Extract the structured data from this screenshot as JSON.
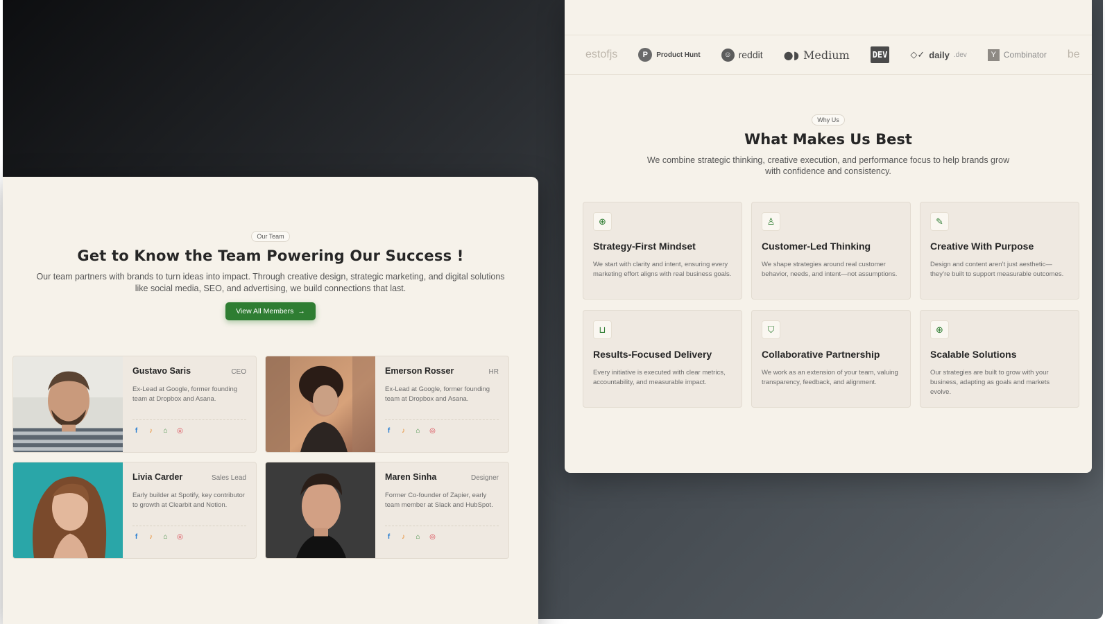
{
  "team": {
    "badge": "Our Team",
    "title": "Get to Know the Team Powering Our Success !",
    "subtitle": "Our team partners with brands to turn ideas into impact. Through creative design, strategic marketing, and digital solutions like social media, SEO, and advertising, we build connections that last.",
    "cta_label": "View All Members",
    "cta_icon": "arrow-right-icon",
    "members": [
      {
        "name": "Gustavo Saris",
        "role": "CEO",
        "bio": "Ex-Lead at Google, former founding team at Dropbox and Asana."
      },
      {
        "name": "Emerson Rosser",
        "role": "HR",
        "bio": "Ex-Lead at Google, former founding team at Dropbox and Asana."
      },
      {
        "name": "Livia Carder",
        "role": "Sales Lead",
        "bio": "Early builder at Spotify, key contributor to growth at Clearbit and Notion."
      },
      {
        "name": "Maren Sinha",
        "role": "Designer",
        "bio": "Former Co-founder of Zapier, early team member at Slack and HubSpot."
      }
    ],
    "social_icons": [
      "facebook-icon",
      "twitter-icon",
      "github-icon",
      "instagram-icon"
    ],
    "colors": {
      "accent": "#2e7d32",
      "facebook": "#2b7fd1",
      "twitter": "#e68a2e",
      "github": "#3c8c40",
      "instagram": "#d8434f"
    }
  },
  "logos": {
    "bestofjs": "estofjs",
    "product_hunt": "Product Hunt",
    "product_hunt_mark": "P",
    "reddit": "reddit",
    "medium": "Medium",
    "dev": "DEV",
    "daily": "daily",
    "daily_suffix": ".dev",
    "yc_mark": "Y",
    "yc": "Combinator",
    "trailing": "be"
  },
  "why": {
    "badge": "Why Us",
    "title": "What Makes Us Best",
    "subtitle": "We combine strategic thinking, creative execution, and performance focus to help brands grow with confidence and consistency.",
    "features": [
      {
        "title": "Strategy-First Mindset",
        "desc": "We start with clarity and intent, ensuring every marketing effort aligns with real business goals.",
        "icon": "compass-icon"
      },
      {
        "title": "Customer-Led Thinking",
        "desc": "We shape strategies around real customer behavior, needs, and intent—not assumptions.",
        "icon": "user-icon"
      },
      {
        "title": "Creative With Purpose",
        "desc": "Design and content aren’t just aesthetic—they’re built to support measurable outcomes.",
        "icon": "pen-icon"
      },
      {
        "title": "Results-Focused Delivery",
        "desc": "Every initiative is executed with clear metrics, accountability, and measurable impact.",
        "icon": "cart-icon"
      },
      {
        "title": "Collaborative Partnership",
        "desc": "We work as an extension of your team, valuing transparency, feedback, and alignment.",
        "icon": "handshake-icon"
      },
      {
        "title": "Scalable Solutions",
        "desc": "Our strategies are built to grow with your business, adapting as goals and markets evolve.",
        "icon": "zoom-in-icon"
      }
    ]
  }
}
